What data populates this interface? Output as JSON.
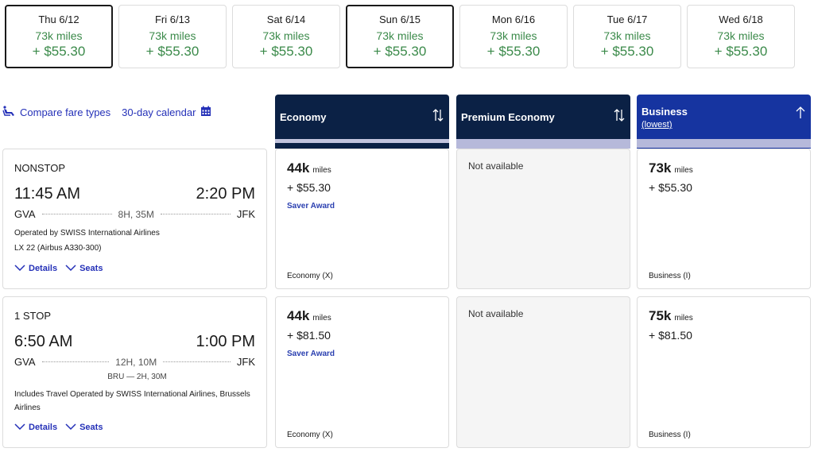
{
  "date_strip": [
    {
      "day": "Thu 6/12",
      "miles": "73k miles",
      "price": "+ $55.30",
      "selected": true
    },
    {
      "day": "Fri 6/13",
      "miles": "73k miles",
      "price": "+ $55.30",
      "selected": false
    },
    {
      "day": "Sat 6/14",
      "miles": "73k miles",
      "price": "+ $55.30",
      "selected": false
    },
    {
      "day": "Sun 6/15",
      "miles": "73k miles",
      "price": "+ $55.30",
      "selected": true
    },
    {
      "day": "Mon 6/16",
      "miles": "73k miles",
      "price": "+ $55.30",
      "selected": false
    },
    {
      "day": "Tue 6/17",
      "miles": "73k miles",
      "price": "+ $55.30",
      "selected": false
    },
    {
      "day": "Wed 6/18",
      "miles": "73k miles",
      "price": "+ $55.30",
      "selected": false
    }
  ],
  "links": {
    "compare_fare_types": "Compare fare types",
    "compare_icon": "seat-icon",
    "calendar": "30-day calendar",
    "calendar_icon": "calendar-icon"
  },
  "columns": [
    {
      "title": "Economy",
      "subtitle": "",
      "sort_icon": "sort-both-icon"
    },
    {
      "title": "Premium Economy",
      "subtitle": "",
      "sort_icon": "sort-both-icon"
    },
    {
      "title": "Business",
      "subtitle": "(lowest)",
      "sort_icon": "sort-up-icon"
    }
  ],
  "flights": [
    {
      "stops": "NONSTOP",
      "depart_time": "11:45 AM",
      "arrive_time": "2:20 PM",
      "origin": "GVA",
      "destination": "JFK",
      "duration": "8H, 35M",
      "layover": "",
      "operated_by": "Operated by SWISS International Airlines",
      "flight_number": "LX 22 (Airbus A330-300)",
      "details_label": "Details",
      "seats_label": "Seats",
      "fares": [
        {
          "miles": "44k",
          "unit": "miles",
          "cash": "+ $55.30",
          "award": "Saver Award",
          "cabin": "Economy (X)",
          "available": true
        },
        {
          "not_available": "Not available",
          "available": false
        },
        {
          "miles": "73k",
          "unit": "miles",
          "cash": "+ $55.30",
          "award": "",
          "cabin": "Business (I)",
          "available": true
        }
      ]
    },
    {
      "stops": "1 STOP",
      "depart_time": "6:50 AM",
      "arrive_time": "1:00 PM",
      "origin": "GVA",
      "destination": "JFK",
      "duration": "12H, 10M",
      "layover": "BRU — 2H, 30M",
      "operated_by": "Includes Travel Operated by SWISS International Airlines, Brussels Airlines",
      "flight_number": "",
      "details_label": "Details",
      "seats_label": "Seats",
      "fares": [
        {
          "miles": "44k",
          "unit": "miles",
          "cash": "+ $81.50",
          "award": "Saver Award",
          "cabin": "Economy (X)",
          "available": true
        },
        {
          "not_available": "Not available",
          "available": false
        },
        {
          "miles": "75k",
          "unit": "miles",
          "cash": "+ $81.50",
          "award": "",
          "cabin": "Business (I)",
          "available": true
        }
      ]
    }
  ],
  "colors": {
    "price_green": "#3b8a4a",
    "link_blue": "#2531b8",
    "header_navy": "#0b2145",
    "header_business_blue": "#1634a0",
    "header_strip": "#b6b9da"
  }
}
